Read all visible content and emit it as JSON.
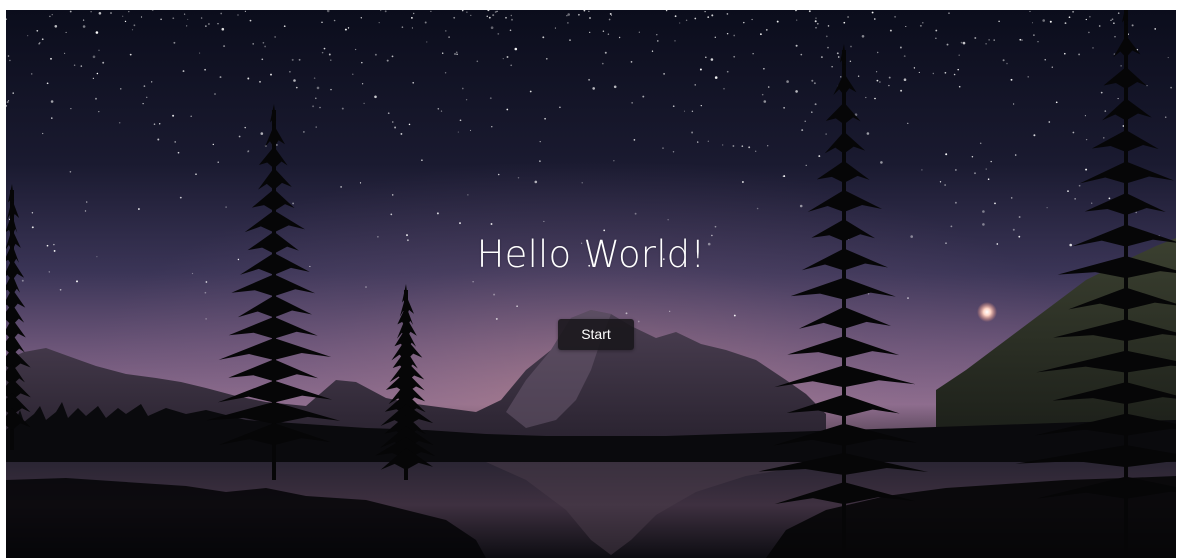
{
  "hero": {
    "title": "Hello World!",
    "start_label": "Start"
  },
  "colors": {
    "sky_top": "#0b0d1c",
    "sky_mid": "#3b3557",
    "horizon_glow": "#8e6d8e",
    "tree_silhouette": "#070708",
    "lake": "#161722",
    "button_bg": "#1b1a1e",
    "text": "#ffffff"
  },
  "background": {
    "icon": "starry-night-lake-landscape"
  }
}
